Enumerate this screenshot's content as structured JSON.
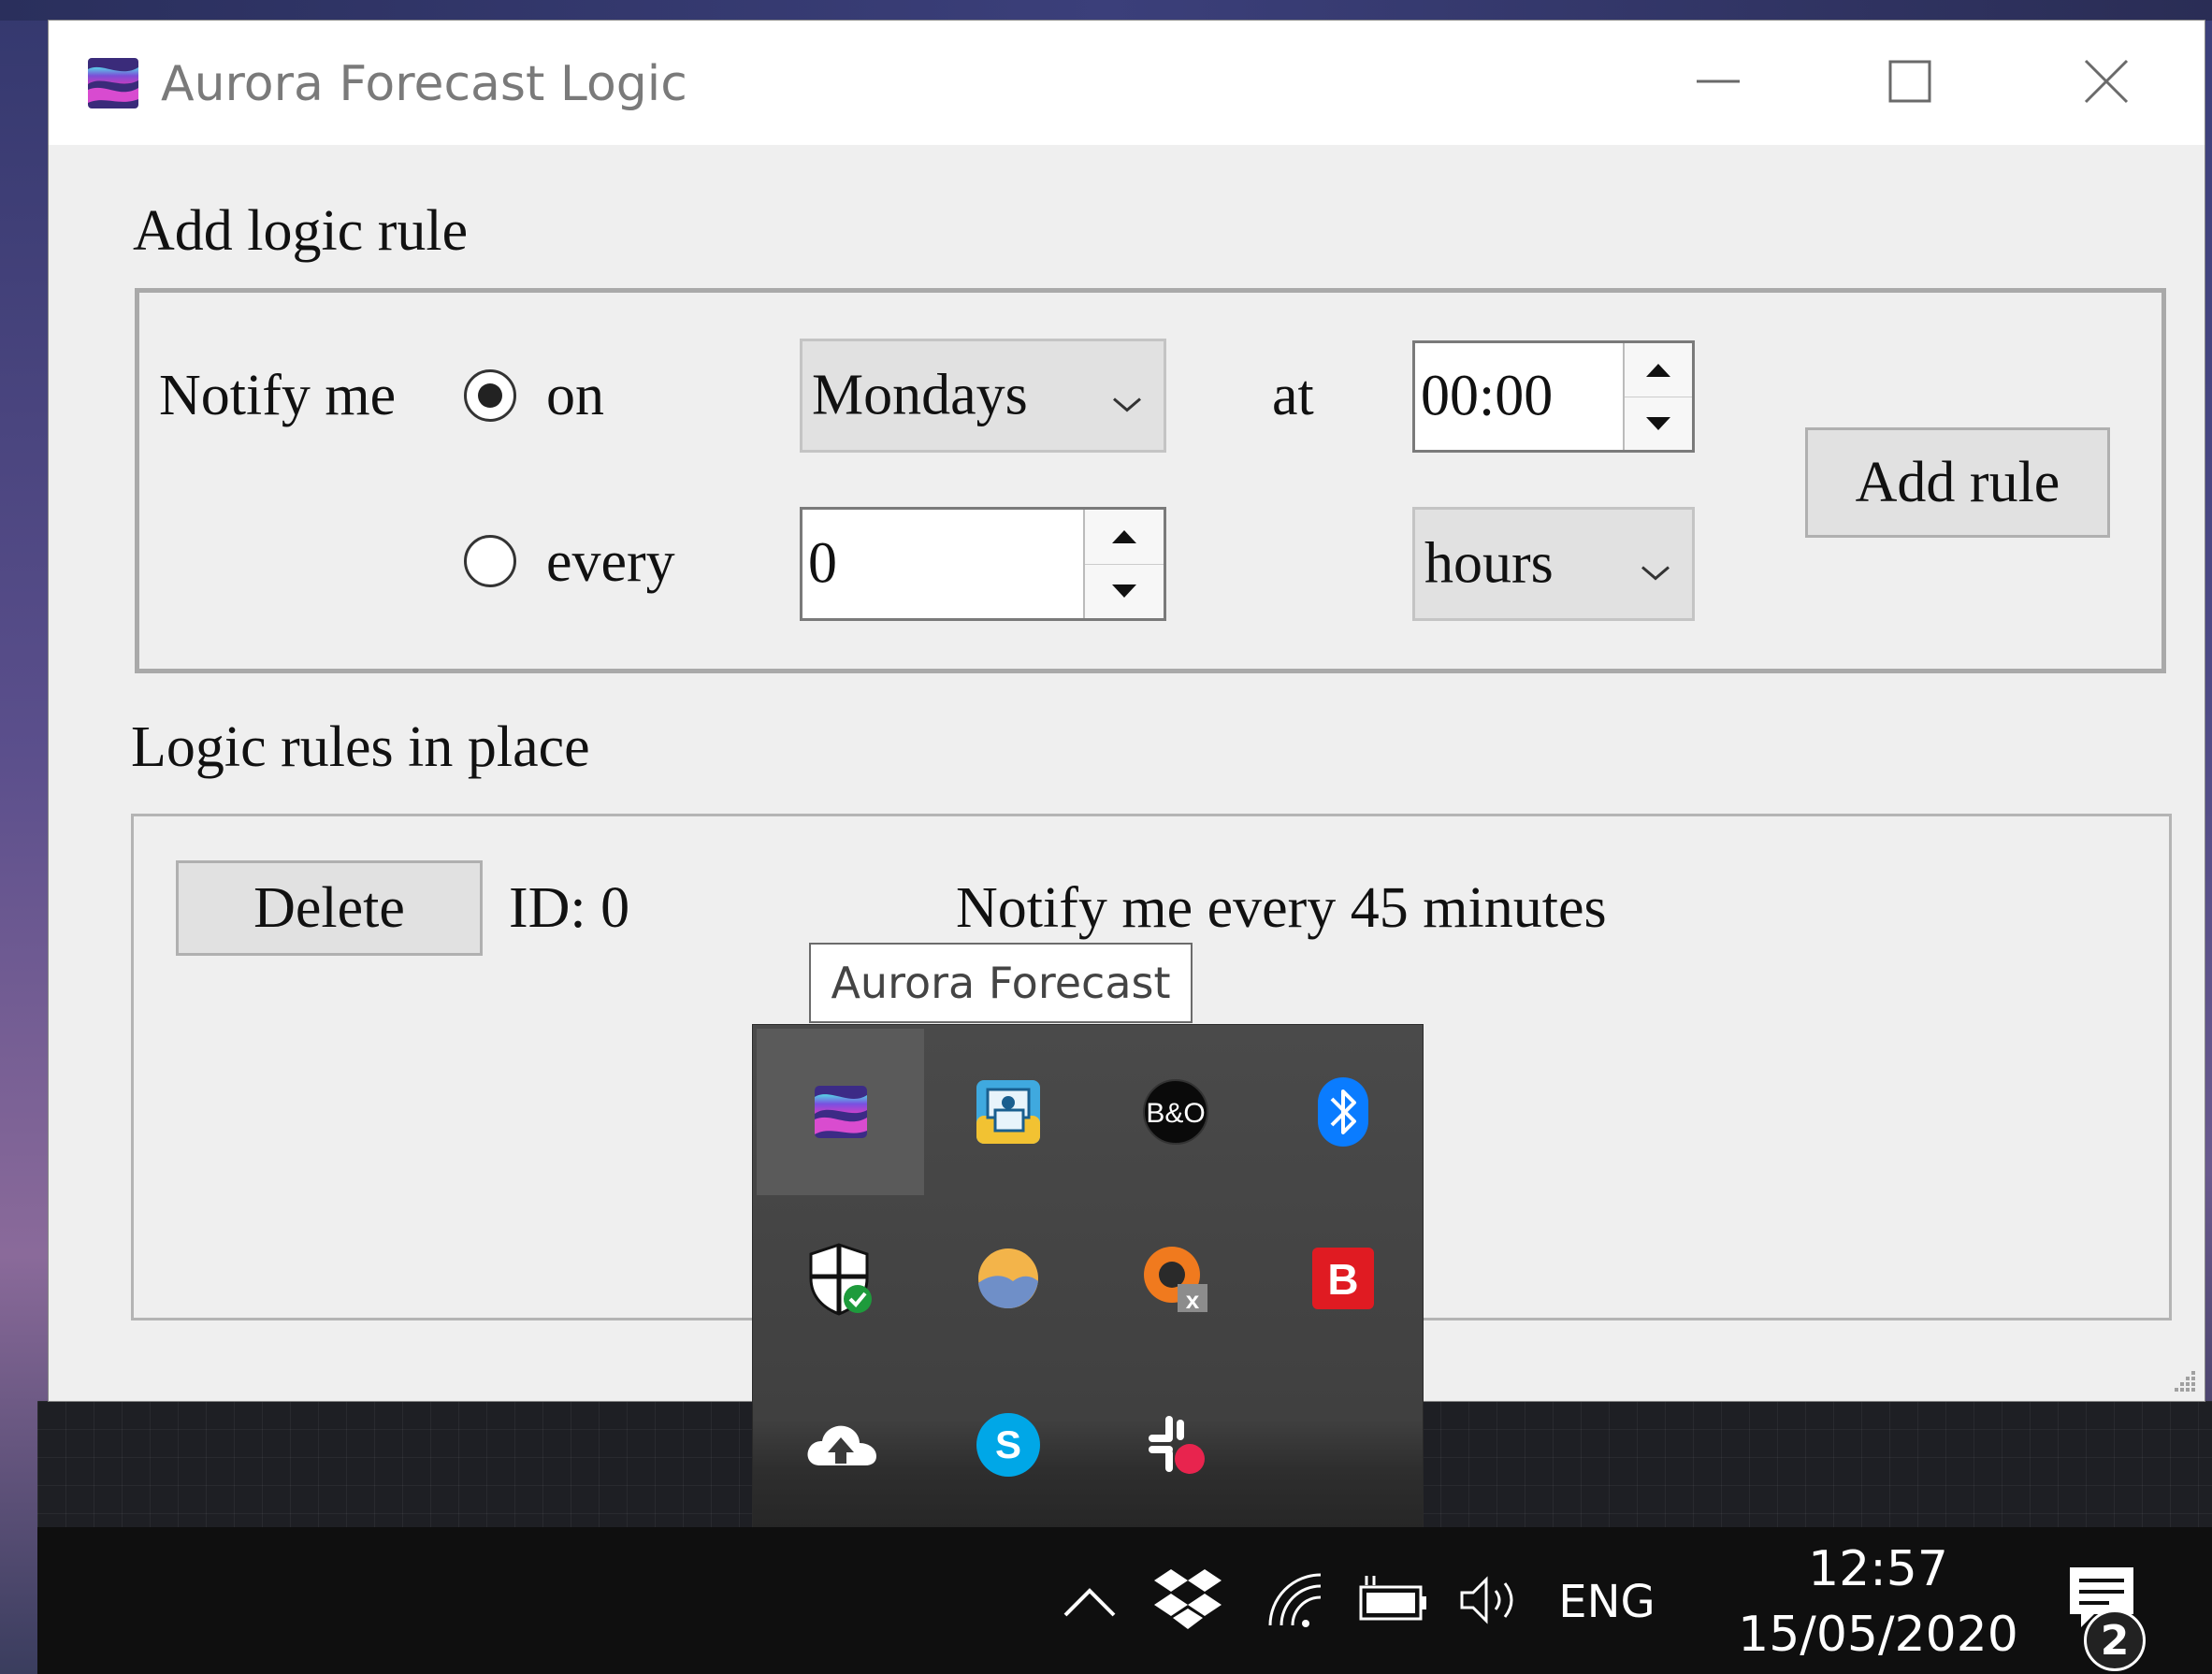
{
  "window": {
    "title": "Aurora Forecast Logic",
    "icons": {
      "app": "aurora-app-icon",
      "minimize": "minimize-icon",
      "maximize": "maximize-icon",
      "close": "close-icon"
    }
  },
  "add_rule": {
    "heading": "Add logic rule",
    "notify_label": "Notify me",
    "on_label": "on",
    "every_label": "every",
    "selected_mode": "on",
    "day_select": {
      "value": "Mondays"
    },
    "at_label": "at",
    "time_input": {
      "value": "00:00"
    },
    "every_input": {
      "value": "0"
    },
    "unit_select": {
      "value": "hours"
    },
    "add_button": "Add rule"
  },
  "rules": {
    "heading": "Logic rules in place",
    "items": [
      {
        "delete_label": "Delete",
        "id_text": "ID: 0",
        "description": "Notify me every 45 minutes"
      }
    ]
  },
  "tooltip": {
    "text": "Aurora Forecast"
  },
  "tray_overflow": {
    "icons": [
      "aurora-forecast-icon",
      "intel-graphics-icon",
      "bang-olufsen-icon",
      "bluetooth-icon",
      "windows-security-icon",
      "weather-app-icon",
      "plex-icon",
      "bitdefender-icon",
      "onedrive-upload-icon",
      "skype-icon",
      "slack-icon"
    ],
    "bo_text": "B&O",
    "bitdefender_letter": "B",
    "skype_letter": "S"
  },
  "taskbar": {
    "language": "ENG",
    "time": "12:57",
    "date": "15/05/2020",
    "notification_count": "2",
    "icons": [
      "chevron-up-icon",
      "dropbox-icon",
      "wifi-icon",
      "battery-icon",
      "volume-icon",
      "action-center-icon"
    ]
  },
  "colors": {
    "window_bg": "#efefef",
    "titlebar_bg": "#ffffff",
    "taskbar_bg": "#0f0f0f",
    "flyout_bg": "#4a4a4a",
    "bluetooth": "#0a7cff",
    "skype": "#00a7e7",
    "bitdefender": "#e01b22"
  }
}
